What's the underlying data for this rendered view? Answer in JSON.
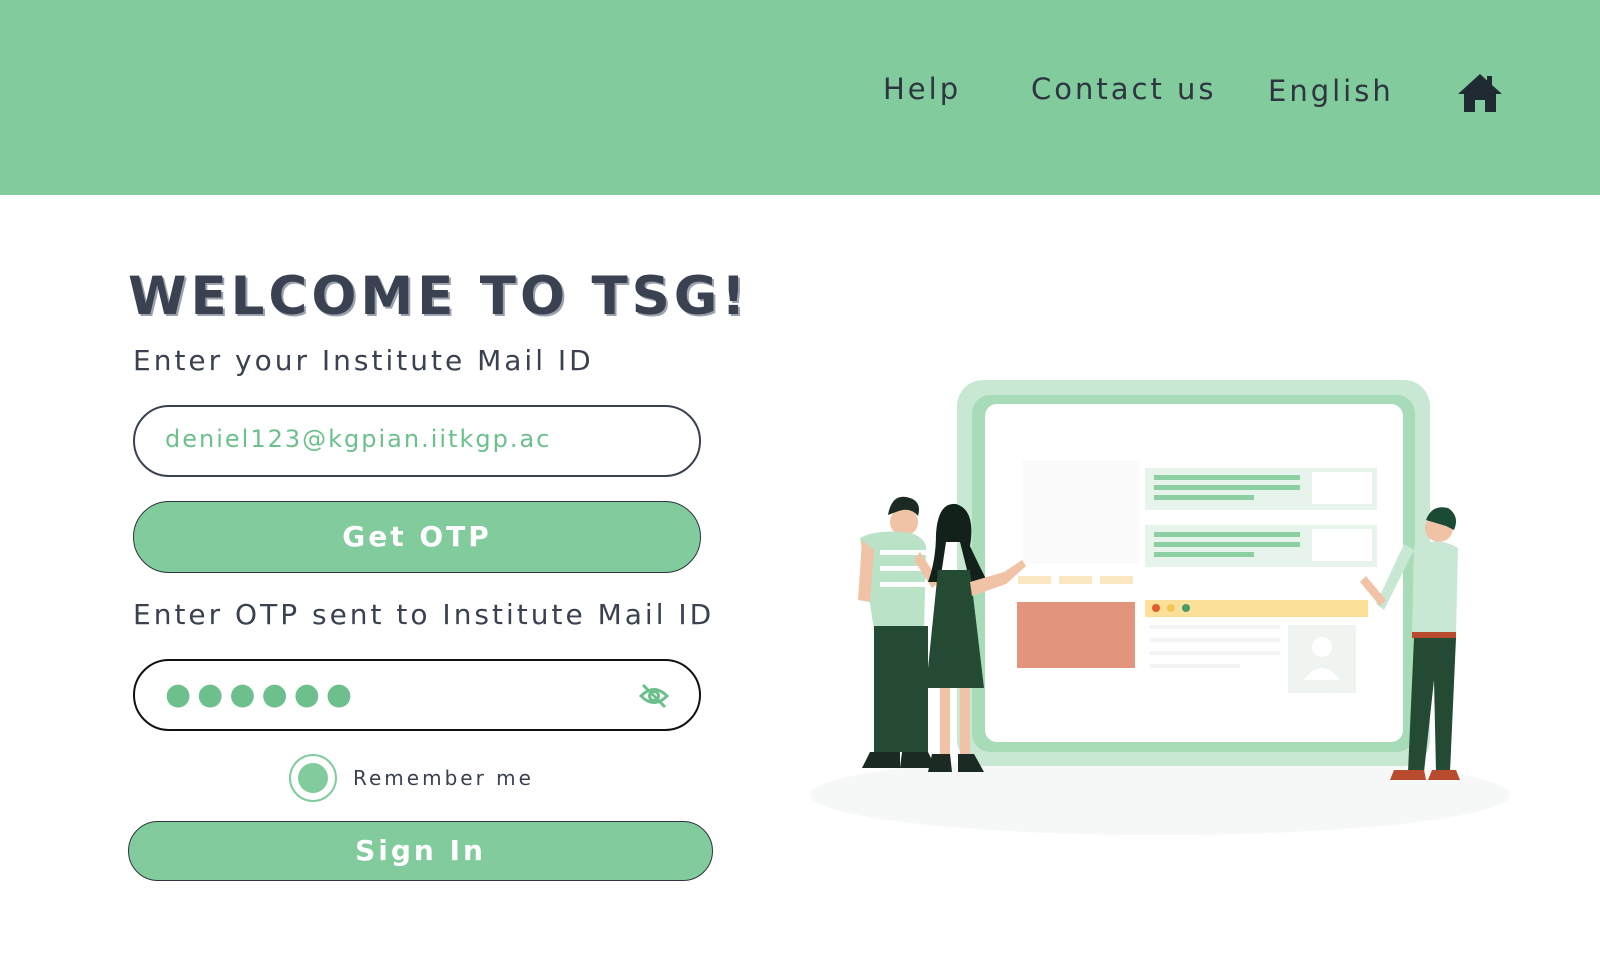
{
  "header": {
    "nav": {
      "help": "Help",
      "contact": "Contact us",
      "language": "English"
    },
    "home_icon": "home-icon",
    "background_color": "#81cb9c"
  },
  "login": {
    "title": "WELCOME TO TSG!",
    "mail_label": "Enter your Institute Mail ID",
    "email_value": "deniel123@kgpian.iitkgp.ac",
    "get_otp_label": "Get OTP",
    "otp_label": "Enter OTP sent to Institute Mail ID",
    "otp_masked": "●●●●●●",
    "otp_visibility_icon": "eye-off-icon",
    "remember_label": "Remember me",
    "remember_checked": true,
    "sign_in_label": "Sign In"
  },
  "colors": {
    "accent": "#81cb9c",
    "text": "#3a4150",
    "dark_green": "#244a33",
    "salmon": "#e2947c",
    "yellow": "#fbe09a"
  }
}
